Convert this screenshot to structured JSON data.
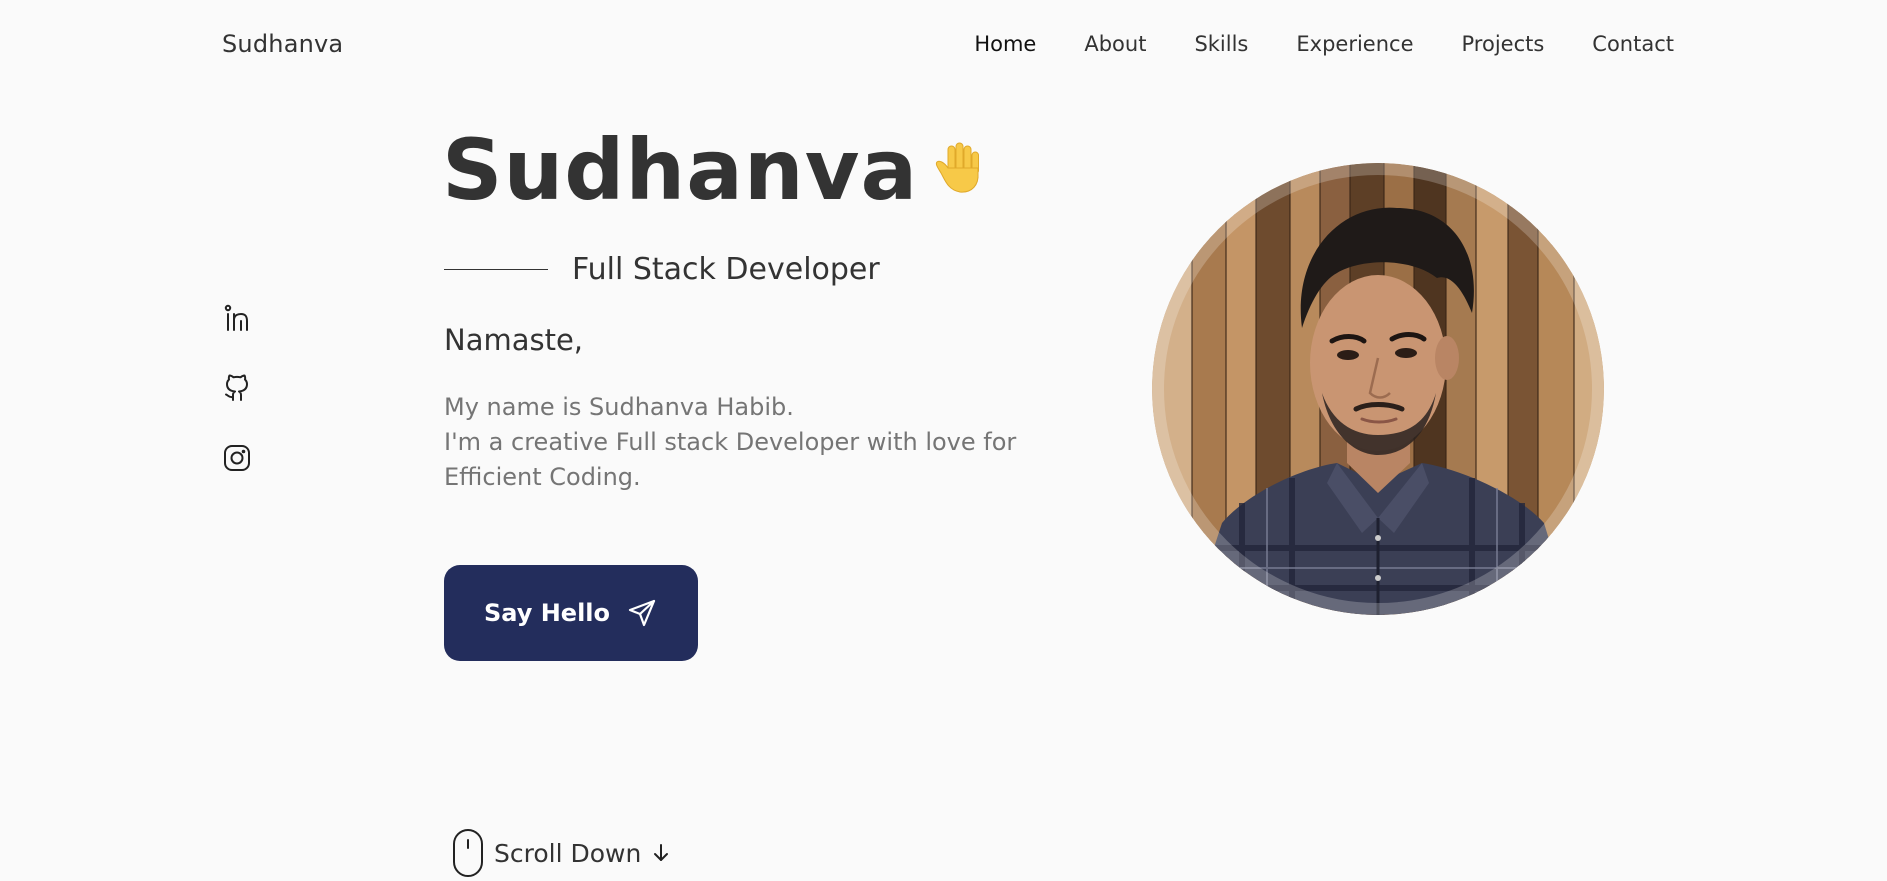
{
  "header": {
    "logo": "Sudhanva",
    "nav": [
      {
        "label": "Home",
        "active": true
      },
      {
        "label": "About",
        "active": false
      },
      {
        "label": "Skills",
        "active": false
      },
      {
        "label": "Experience",
        "active": false
      },
      {
        "label": "Projects",
        "active": false
      },
      {
        "label": "Contact",
        "active": false
      }
    ]
  },
  "social": [
    {
      "icon": "linkedin-icon"
    },
    {
      "icon": "github-icon"
    },
    {
      "icon": "instagram-icon"
    }
  ],
  "hero": {
    "name": "Sudhanva",
    "wave_icon": "waving-hand-icon",
    "role": "Full Stack Developer",
    "greeting": "Namaste,",
    "description_lines": [
      "My name is Sudhanva Habib.",
      "I'm a creative Full stack Developer with love for",
      "Efficient Coding."
    ],
    "cta_label": "Say Hello",
    "cta_icon": "send-icon"
  },
  "scroll": {
    "label": "Scroll Down",
    "mouse_icon": "mouse-icon",
    "arrow_icon": "arrow-down-icon"
  },
  "colors": {
    "background": "#fafafa",
    "text": "#333333",
    "muted": "#757575",
    "button": "#232d5c"
  }
}
